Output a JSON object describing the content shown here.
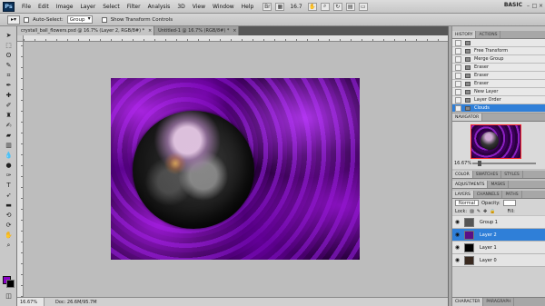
{
  "app": {
    "logo": "Ps"
  },
  "menubar": {
    "items": [
      "File",
      "Edit",
      "Image",
      "Layer",
      "Select",
      "Filter",
      "Analysis",
      "3D",
      "View",
      "Window",
      "Help"
    ],
    "zoom": "16.7",
    "workspace": "BASIC",
    "icons": [
      "launch-bridge-icon",
      "view-extras-icon",
      "hand-icon",
      "zoom-icon",
      "rotate-view-icon",
      "arrange-icon",
      "screen-mode-icon"
    ]
  },
  "optbar": {
    "auto_select_label": "Auto-Select:",
    "auto_select_value": "Group",
    "transform_label": "Show Transform Controls"
  },
  "tabs": [
    {
      "label": "crystall_ball_flowers.psd @ 16.7% (Layer 2, RGB/8#) *",
      "active": true
    },
    {
      "label": "Untitled-1 @ 16.7% (RGB/8#) *",
      "active": false
    }
  ],
  "status": {
    "zoom": "16.67%",
    "doc_size": "Doc: 26.6M/95.7M"
  },
  "history": {
    "tabs": [
      "HISTORY",
      "ACTIONS"
    ],
    "items": [
      {
        "label": "",
        "selected": false
      },
      {
        "label": "Free Transform",
        "selected": false
      },
      {
        "label": "Merge Group",
        "selected": false
      },
      {
        "label": "Eraser",
        "selected": false
      },
      {
        "label": "Eraser",
        "selected": false
      },
      {
        "label": "Eraser",
        "selected": false
      },
      {
        "label": "New Layer",
        "selected": false
      },
      {
        "label": "Layer Order",
        "selected": false
      },
      {
        "label": "Clouds",
        "selected": true
      }
    ]
  },
  "navigator": {
    "tabs": [
      "NAVIGATOR"
    ],
    "zoom": "16.67%"
  },
  "color_panel": {
    "tabs": [
      "COLOR",
      "SWATCHES",
      "STYLES"
    ]
  },
  "adjust_panel": {
    "tabs": [
      "ADJUSTMENTS",
      "MASKS"
    ]
  },
  "layers": {
    "tabs": [
      "LAYERS",
      "CHANNELS",
      "PATHS"
    ],
    "blend": "Normal",
    "opacity_label": "Opacity:",
    "opacity_value": "",
    "lock_label": "Lock:",
    "fill_label": "Fill:",
    "rows": [
      {
        "name": "Group 1",
        "selected": false,
        "thumb": "#555555"
      },
      {
        "name": "Layer 2",
        "selected": true,
        "thumb": "#5a0f86"
      },
      {
        "name": "Layer 1",
        "selected": false,
        "thumb": "#000000"
      },
      {
        "name": "Layer 0",
        "selected": false,
        "thumb": "#3a2a20"
      }
    ]
  },
  "bottom_tabs": [
    "CHARACTER",
    "PARAGRAPH"
  ],
  "colors": {
    "foreground": "#8a00c8",
    "background": "#000000",
    "selection": "#2f7fd8"
  }
}
